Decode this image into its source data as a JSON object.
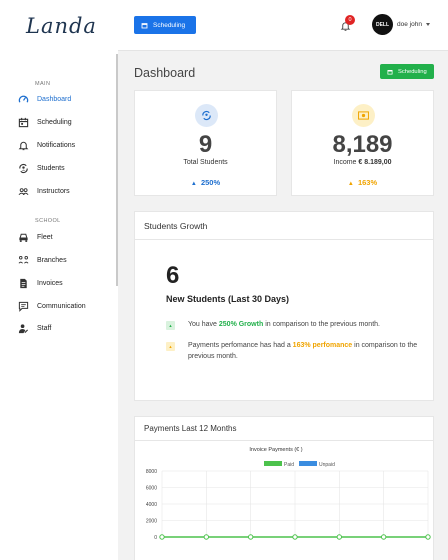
{
  "app": {
    "logo": "Landa"
  },
  "sidebar": {
    "sections": [
      {
        "label": "MAIN",
        "items": [
          {
            "label": "Dashboard",
            "icon": "gauge-icon",
            "active": true
          },
          {
            "label": "Scheduling",
            "icon": "calendar-icon"
          },
          {
            "label": "Notifications",
            "icon": "bell-icon"
          },
          {
            "label": "Students",
            "icon": "students-icon"
          },
          {
            "label": "Instructors",
            "icon": "users-icon"
          }
        ]
      },
      {
        "label": "SCHOOL",
        "items": [
          {
            "label": "Fleet",
            "icon": "car-icon"
          },
          {
            "label": "Branches",
            "icon": "branches-icon"
          },
          {
            "label": "Invoices",
            "icon": "invoice-icon"
          },
          {
            "label": "Communication",
            "icon": "chat-icon"
          },
          {
            "label": "Staff",
            "icon": "staff-icon"
          }
        ]
      }
    ]
  },
  "topbar": {
    "scheduling_label": "Scheduling",
    "notification_count": "0",
    "avatar_text": "DELL",
    "username": "doe john"
  },
  "page": {
    "title": "Dashboard",
    "scheduling_label": "Scheduling"
  },
  "stats": {
    "students": {
      "value": "9",
      "label": "Total Students",
      "trend": "250%",
      "color": "#1e6fcf"
    },
    "income": {
      "value": "8,189",
      "label_prefix": "Income ",
      "label_amount": "€ 8.189,00",
      "trend": "163%",
      "color": "#f0a400"
    }
  },
  "growth": {
    "title": "Students Growth",
    "count": "6",
    "subtitle": "New Students (Last 30 Days)",
    "notes": [
      {
        "pre": "You have ",
        "highlight": "250% Growth",
        "post": " in comparison to the previous month."
      },
      {
        "pre": "Payments perfomance has had a ",
        "highlight": "163% perfomance",
        "post": " in comparison to the previous month."
      }
    ]
  },
  "payments": {
    "title": "Payments Last 12 Months"
  },
  "chart_data": {
    "type": "line",
    "title": "Invoice Payments (€ )",
    "legend": [
      "Paid",
      "Unpaid"
    ],
    "legend_position": "top",
    "colors": {
      "Paid": "#4cc24c",
      "Unpaid": "#3b8de0"
    },
    "y_ticks": [
      "8000",
      "6000",
      "4000",
      "2000",
      "0"
    ],
    "ylim": [
      0,
      8000
    ],
    "grid": true,
    "series": [
      {
        "name": "Paid",
        "values": [
          0,
          0,
          0,
          0,
          0,
          0,
          0
        ]
      }
    ]
  }
}
